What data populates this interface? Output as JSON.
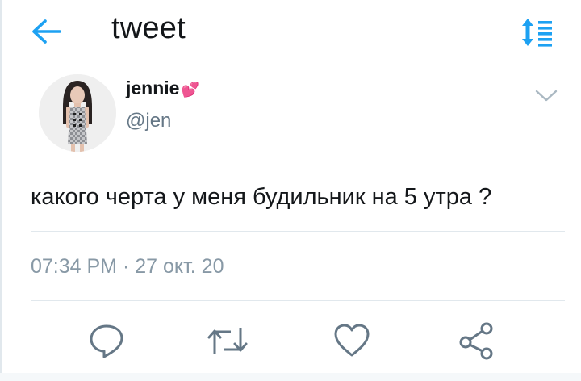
{
  "header": {
    "title": "tweet",
    "back_icon": "arrow-left-icon",
    "sort_icon": "sort-arrows-icon",
    "accent_color": "#1da1f2"
  },
  "tweet": {
    "author": {
      "name": "jennie",
      "handle": "@jen",
      "name_emoji": "💕"
    },
    "text": "какого черта у меня будильник на 5 утра ?",
    "timestamp": "07:34 PM · 27 окт. 20"
  },
  "actions": {
    "reply_icon": "reply-icon",
    "retweet_icon": "retweet-icon",
    "like_icon": "heart-icon",
    "share_icon": "share-icon",
    "icon_color": "#657786"
  }
}
